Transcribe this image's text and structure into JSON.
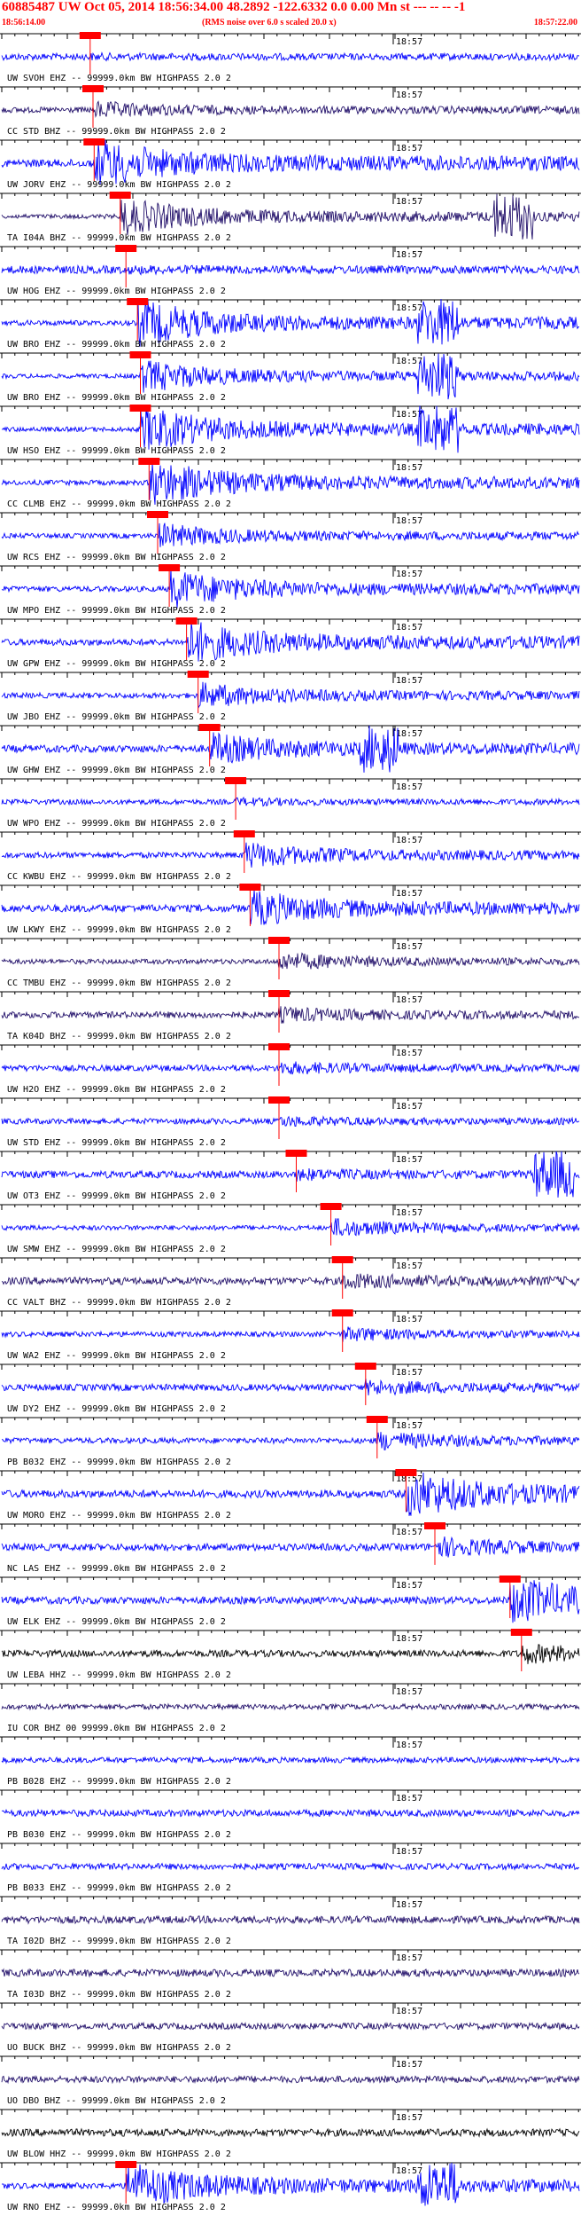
{
  "header": {
    "title": "60885487 UW Oct 05, 2014 18:56:34.00   48.2892 -122.6332  0.0 0.00 Mn st --- -- -- -1",
    "start_time": "18:56:14.00",
    "note": "(RMS noise over 6.0 s scaled 20.0 x)",
    "end_time": "18:57:22.00"
  },
  "time_label": "18:57",
  "colors": {
    "header_text": "#ff0000",
    "trace_blue": "#0000ff",
    "trace_navy": "#22106a",
    "trace_black": "#000000",
    "pick": "#ff0000",
    "axis": "#000000"
  },
  "traces": [
    {
      "label": "UW SVOH EHZ -- 99999.0km BW  HIGHPASS  2.0  2",
      "color": "#0000ff",
      "pick": 0.153,
      "burst": 0.03,
      "late": 0
    },
    {
      "label": "CC STD BHZ -- 99999.0km BW  HIGHPASS  2.0  2",
      "color": "#22106a",
      "pick": 0.158,
      "burst": 0.3,
      "late": 0
    },
    {
      "label": "UW JORV EHZ -- 99999.0km BW  HIGHPASS  2.0  2",
      "color": "#0000ff",
      "pick": 0.16,
      "burst": 1.0,
      "late": 0
    },
    {
      "label": "TA I04A BHZ -- 99999.0km BW  HIGHPASS  2.0  2",
      "color": "#22106a",
      "pick": 0.205,
      "burst": 0.8,
      "late": 0.85
    },
    {
      "label": "UW HOG EHZ -- 99999.0km BW  HIGHPASS  2.0  2",
      "color": "#0000ff",
      "pick": 0.215,
      "burst": 0.05,
      "late": 0
    },
    {
      "label": "UW BRO EHZ -- 99999.0km BW  HIGHPASS  2.0  2",
      "color": "#0000ff",
      "pick": 0.235,
      "burst": 1.0,
      "late": 0.72
    },
    {
      "label": "UW BRO EHZ -- 99999.0km BW  HIGHPASS  2.0  2",
      "color": "#0000ff",
      "pick": 0.24,
      "burst": 0.7,
      "late": 0.72
    },
    {
      "label": "UW HSO EHZ -- 99999.0km BW  HIGHPASS  2.0  2",
      "color": "#0000ff",
      "pick": 0.24,
      "burst": 1.0,
      "late": 0.72
    },
    {
      "label": "CC CLMB EHZ -- 99999.0km BW  HIGHPASS  2.0  2",
      "color": "#0000ff",
      "pick": 0.255,
      "burst": 1.0,
      "late": 0
    },
    {
      "label": "UW RCS EHZ -- 99999.0km BW  HIGHPASS  2.0  2",
      "color": "#0000ff",
      "pick": 0.27,
      "burst": 0.5,
      "late": 0
    },
    {
      "label": "UW MPO EHZ -- 99999.0km BW  HIGHPASS  2.0  2",
      "color": "#0000ff",
      "pick": 0.29,
      "burst": 0.8,
      "late": 0
    },
    {
      "label": "UW GPW EHZ -- 99999.0km BW  HIGHPASS  2.0  2",
      "color": "#0000ff",
      "pick": 0.32,
      "burst": 0.9,
      "late": 0
    },
    {
      "label": "UW JBO EHZ -- 99999.0km BW  HIGHPASS  2.0  2",
      "color": "#0000ff",
      "pick": 0.34,
      "burst": 0.5,
      "late": 0
    },
    {
      "label": "UW GHW EHZ -- 99999.0km BW  HIGHPASS  2.0  2",
      "color": "#0000ff",
      "pick": 0.36,
      "burst": 0.6,
      "late": 0.62
    },
    {
      "label": "UW WPO EHZ -- 99999.0km BW  HIGHPASS  2.0  2",
      "color": "#0000ff",
      "pick": 0.405,
      "burst": 0.1,
      "late": 0
    },
    {
      "label": "CC KWBU EHZ -- 99999.0km BW  HIGHPASS  2.0  2",
      "color": "#0000ff",
      "pick": 0.42,
      "burst": 0.5,
      "late": 0
    },
    {
      "label": "UW LKWY EHZ -- 99999.0km BW  HIGHPASS  2.0  2",
      "color": "#0000ff",
      "pick": 0.43,
      "burst": 0.7,
      "late": 0
    },
    {
      "label": "CC TMBU EHZ -- 99999.0km BW  HIGHPASS  2.0  2",
      "color": "#22106a",
      "pick": 0.48,
      "burst": 0.35,
      "late": 0
    },
    {
      "label": "TA K04D BHZ -- 99999.0km BW  HIGHPASS  2.0  2",
      "color": "#22106a",
      "pick": 0.48,
      "burst": 0.25,
      "late": 0
    },
    {
      "label": "UW H2O EHZ -- 99999.0km BW  HIGHPASS  2.0  2",
      "color": "#0000ff",
      "pick": 0.48,
      "burst": 0.2,
      "late": 0
    },
    {
      "label": "UW STD EHZ -- 99999.0km BW  HIGHPASS  2.0  2",
      "color": "#0000ff",
      "pick": 0.48,
      "burst": 0.15,
      "late": 0
    },
    {
      "label": "UW OT3 EHZ -- 99999.0km BW  HIGHPASS  2.0  2",
      "color": "#0000ff",
      "pick": 0.51,
      "burst": 0.15,
      "late": 0.92
    },
    {
      "label": "UW SMW EHZ -- 99999.0km BW  HIGHPASS  2.0  2",
      "color": "#0000ff",
      "pick": 0.57,
      "burst": 0.35,
      "late": 0
    },
    {
      "label": "CC VALT BHZ -- 99999.0km BW  HIGHPASS  2.0  2",
      "color": "#22106a",
      "pick": 0.59,
      "burst": 0.25,
      "late": 0
    },
    {
      "label": "UW WA2 EHZ -- 99999.0km BW  HIGHPASS  2.0  2",
      "color": "#0000ff",
      "pick": 0.59,
      "burst": 0.25,
      "late": 0
    },
    {
      "label": "UW DY2 EHZ -- 99999.0km BW  HIGHPASS  2.0  2",
      "color": "#0000ff",
      "pick": 0.63,
      "burst": 0.25,
      "late": 0
    },
    {
      "label": "PB B032 EHZ -- 99999.0km BW  HIGHPASS  2.0  2",
      "color": "#0000ff",
      "pick": 0.65,
      "burst": 0.35,
      "late": 0
    },
    {
      "label": "UW MORO EHZ -- 99999.0km BW  HIGHPASS  2.0  2",
      "color": "#0000ff",
      "pick": 0.7,
      "burst": 1.0,
      "late": 0
    },
    {
      "label": "NC LAS EHZ -- 99999.0km BW  HIGHPASS  2.0  2",
      "color": "#0000ff",
      "pick": 0.75,
      "burst": 0.35,
      "late": 0
    },
    {
      "label": "UW ELK EHZ -- 99999.0km BW  HIGHPASS  2.0  2",
      "color": "#0000ff",
      "pick": 0.88,
      "burst": 1.0,
      "late": 0
    },
    {
      "label": "UW LEBA HHZ -- 99999.0km BW  HIGHPASS  2.0  2",
      "color": "#000000",
      "pick": 0.9,
      "burst": 0.35,
      "late": 0
    },
    {
      "label": "IU COR BHZ 00 99999.0km BW  HIGHPASS  2.0  2",
      "color": "#22106a",
      "pick": -1,
      "burst": 0,
      "late": 0
    },
    {
      "label": "PB B028 EHZ -- 99999.0km BW  HIGHPASS  2.0  2",
      "color": "#0000ff",
      "pick": -1,
      "burst": 0,
      "late": 0
    },
    {
      "label": "PB B030 EHZ -- 99999.0km BW  HIGHPASS  2.0  2",
      "color": "#0000ff",
      "pick": -1,
      "burst": 0,
      "late": 0
    },
    {
      "label": "PB B033 EHZ -- 99999.0km BW  HIGHPASS  2.0  2",
      "color": "#0000ff",
      "pick": -1,
      "burst": 0,
      "late": 0
    },
    {
      "label": "TA I02D BHZ -- 99999.0km BW  HIGHPASS  2.0  2",
      "color": "#22106a",
      "pick": -1,
      "burst": 0,
      "late": 0
    },
    {
      "label": "TA I03D BHZ -- 99999.0km BW  HIGHPASS  2.0  2",
      "color": "#22106a",
      "pick": -1,
      "burst": 0.3,
      "late": 0
    },
    {
      "label": "UO BUCK BHZ -- 99999.0km BW  HIGHPASS  2.0  2",
      "color": "#22106a",
      "pick": -1,
      "burst": 0,
      "late": 0
    },
    {
      "label": "UO DBO BHZ -- 99999.0km BW  HIGHPASS  2.0  2",
      "color": "#22106a",
      "pick": -1,
      "burst": 0,
      "late": 0
    },
    {
      "label": "UW BLOW HHZ -- 99999.0km BW  HIGHPASS  2.0  2",
      "color": "#000000",
      "pick": -1,
      "burst": 0,
      "late": 0
    },
    {
      "label": "UW RNO EHZ -- 99999.0km BW  HIGHPASS  2.0  2",
      "color": "#0000ff",
      "pick": 0.215,
      "burst": 1.0,
      "late": 0.72
    }
  ]
}
